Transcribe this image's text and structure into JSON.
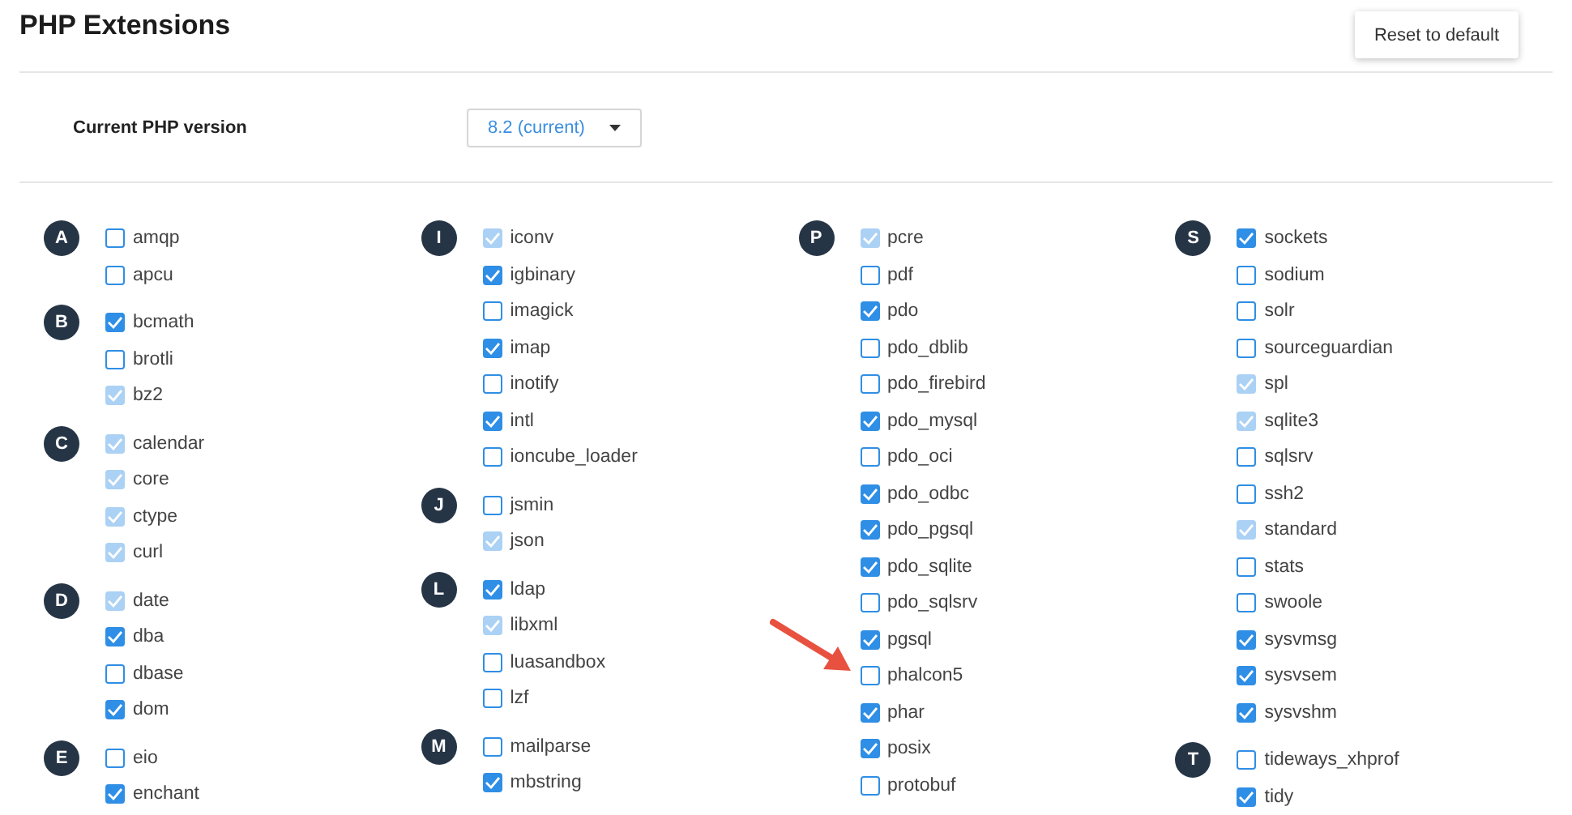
{
  "title": "PHP Extensions",
  "reset_button": "Reset to default",
  "php_version": {
    "label": "Current PHP version",
    "value": "8.2 (current)"
  },
  "columns": [
    {
      "groups": [
        {
          "letter": "A",
          "items": [
            {
              "name": "amqp",
              "checked": false,
              "disabled": false
            },
            {
              "name": "apcu",
              "checked": false,
              "disabled": false
            }
          ]
        },
        {
          "letter": "B",
          "items": [
            {
              "name": "bcmath",
              "checked": true,
              "disabled": false
            },
            {
              "name": "brotli",
              "checked": false,
              "disabled": false
            },
            {
              "name": "bz2",
              "checked": true,
              "disabled": true
            }
          ]
        },
        {
          "letter": "C",
          "items": [
            {
              "name": "calendar",
              "checked": true,
              "disabled": true
            },
            {
              "name": "core",
              "checked": true,
              "disabled": true
            },
            {
              "name": "ctype",
              "checked": true,
              "disabled": true
            },
            {
              "name": "curl",
              "checked": true,
              "disabled": true
            }
          ]
        },
        {
          "letter": "D",
          "items": [
            {
              "name": "date",
              "checked": true,
              "disabled": true
            },
            {
              "name": "dba",
              "checked": true,
              "disabled": false
            },
            {
              "name": "dbase",
              "checked": false,
              "disabled": false
            },
            {
              "name": "dom",
              "checked": true,
              "disabled": false
            }
          ]
        },
        {
          "letter": "E",
          "items": [
            {
              "name": "eio",
              "checked": false,
              "disabled": false
            },
            {
              "name": "enchant",
              "checked": true,
              "disabled": false
            }
          ]
        }
      ]
    },
    {
      "groups": [
        {
          "letter": "I",
          "items": [
            {
              "name": "iconv",
              "checked": true,
              "disabled": true
            },
            {
              "name": "igbinary",
              "checked": true,
              "disabled": false
            },
            {
              "name": "imagick",
              "checked": false,
              "disabled": false
            },
            {
              "name": "imap",
              "checked": true,
              "disabled": false
            },
            {
              "name": "inotify",
              "checked": false,
              "disabled": false
            },
            {
              "name": "intl",
              "checked": true,
              "disabled": false
            },
            {
              "name": "ioncube_loader",
              "checked": false,
              "disabled": false
            }
          ]
        },
        {
          "letter": "J",
          "items": [
            {
              "name": "jsmin",
              "checked": false,
              "disabled": false
            },
            {
              "name": "json",
              "checked": true,
              "disabled": true
            }
          ]
        },
        {
          "letter": "L",
          "items": [
            {
              "name": "ldap",
              "checked": true,
              "disabled": false
            },
            {
              "name": "libxml",
              "checked": true,
              "disabled": true
            },
            {
              "name": "luasandbox",
              "checked": false,
              "disabled": false
            },
            {
              "name": "lzf",
              "checked": false,
              "disabled": false
            }
          ]
        },
        {
          "letter": "M",
          "items": [
            {
              "name": "mailparse",
              "checked": false,
              "disabled": false
            },
            {
              "name": "mbstring",
              "checked": true,
              "disabled": false
            }
          ]
        }
      ]
    },
    {
      "groups": [
        {
          "letter": "P",
          "items": [
            {
              "name": "pcre",
              "checked": true,
              "disabled": true
            },
            {
              "name": "pdf",
              "checked": false,
              "disabled": false
            },
            {
              "name": "pdo",
              "checked": true,
              "disabled": false
            },
            {
              "name": "pdo_dblib",
              "checked": false,
              "disabled": false
            },
            {
              "name": "pdo_firebird",
              "checked": false,
              "disabled": false
            },
            {
              "name": "pdo_mysql",
              "checked": true,
              "disabled": false
            },
            {
              "name": "pdo_oci",
              "checked": false,
              "disabled": false
            },
            {
              "name": "pdo_odbc",
              "checked": true,
              "disabled": false
            },
            {
              "name": "pdo_pgsql",
              "checked": true,
              "disabled": false
            },
            {
              "name": "pdo_sqlite",
              "checked": true,
              "disabled": false
            },
            {
              "name": "pdo_sqlsrv",
              "checked": false,
              "disabled": false
            },
            {
              "name": "pgsql",
              "checked": true,
              "disabled": false
            },
            {
              "name": "phalcon5",
              "checked": false,
              "disabled": false
            },
            {
              "name": "phar",
              "checked": true,
              "disabled": false
            },
            {
              "name": "posix",
              "checked": true,
              "disabled": false
            },
            {
              "name": "protobuf",
              "checked": false,
              "disabled": false
            }
          ]
        }
      ]
    },
    {
      "groups": [
        {
          "letter": "S",
          "items": [
            {
              "name": "sockets",
              "checked": true,
              "disabled": false
            },
            {
              "name": "sodium",
              "checked": false,
              "disabled": false
            },
            {
              "name": "solr",
              "checked": false,
              "disabled": false
            },
            {
              "name": "sourceguardian",
              "checked": false,
              "disabled": false
            },
            {
              "name": "spl",
              "checked": true,
              "disabled": true
            },
            {
              "name": "sqlite3",
              "checked": true,
              "disabled": true
            },
            {
              "name": "sqlsrv",
              "checked": false,
              "disabled": false
            },
            {
              "name": "ssh2",
              "checked": false,
              "disabled": false
            },
            {
              "name": "standard",
              "checked": true,
              "disabled": true
            },
            {
              "name": "stats",
              "checked": false,
              "disabled": false
            },
            {
              "name": "swoole",
              "checked": false,
              "disabled": false
            },
            {
              "name": "sysvmsg",
              "checked": true,
              "disabled": false
            },
            {
              "name": "sysvsem",
              "checked": true,
              "disabled": false
            },
            {
              "name": "sysvshm",
              "checked": true,
              "disabled": false
            }
          ]
        },
        {
          "letter": "T",
          "items": [
            {
              "name": "tideways_xhprof",
              "checked": false,
              "disabled": false
            },
            {
              "name": "tidy",
              "checked": true,
              "disabled": false
            }
          ]
        }
      ]
    }
  ]
}
